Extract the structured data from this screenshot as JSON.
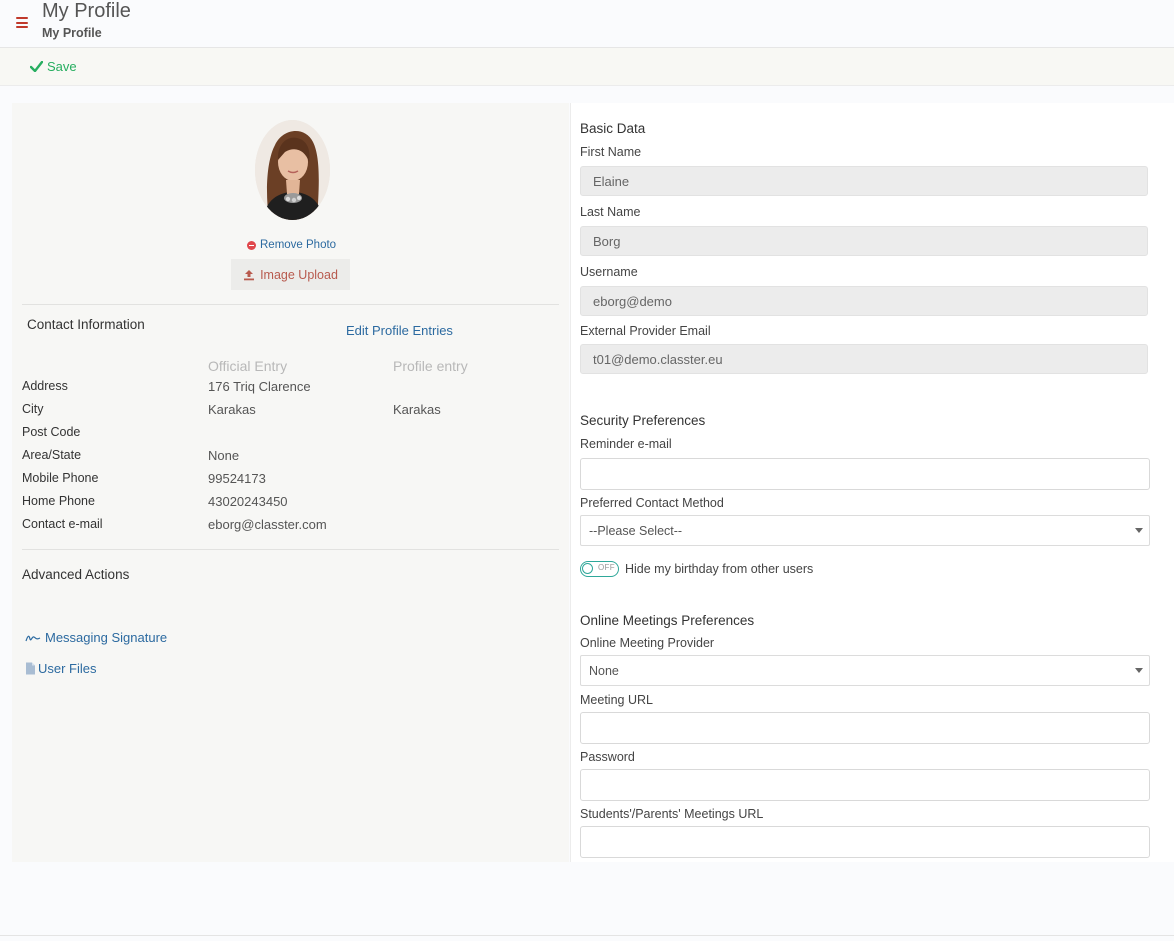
{
  "header": {
    "title": "My Profile",
    "subtitle": "My Profile",
    "menu_icon": "hamburger-icon",
    "accent_color": "#c0392b"
  },
  "toolbar": {
    "save_label": "Save",
    "save_color": "#27ae60"
  },
  "photo": {
    "remove_label": "Remove Photo",
    "upload_label": "Image Upload"
  },
  "contact": {
    "title": "Contact Information",
    "edit_label": "Edit Profile Entries",
    "col_official": "Official Entry",
    "col_profile": "Profile entry",
    "rows": [
      {
        "label": "Address",
        "official": "176 Triq Clarence",
        "profile": ""
      },
      {
        "label": "City",
        "official": "Karakas",
        "profile": "Karakas"
      },
      {
        "label": "Post Code",
        "official": "",
        "profile": ""
      },
      {
        "label": "Area/State",
        "official": "None",
        "profile": ""
      },
      {
        "label": "Mobile Phone",
        "official": "99524173",
        "profile": ""
      },
      {
        "label": "Home Phone",
        "official": "43020243450",
        "profile": ""
      },
      {
        "label": "Contact e-mail",
        "official": "eborg@classter.com",
        "profile": ""
      }
    ]
  },
  "advanced": {
    "title": "Advanced Actions",
    "messaging_signature": "Messaging Signature",
    "user_files": "User Files"
  },
  "basic": {
    "title": "Basic Data",
    "first_name_label": "First Name",
    "first_name": "Elaine",
    "last_name_label": "Last Name",
    "last_name": "Borg",
    "username_label": "Username",
    "username": "eborg@demo",
    "ext_email_label": "External Provider Email",
    "ext_email": "t01@demo.classter.eu"
  },
  "security": {
    "title": "Security Preferences",
    "reminder_label": "Reminder e-mail",
    "reminder_value": "",
    "contact_method_label": "Preferred Contact Method",
    "contact_method_value": "--Please Select--",
    "toggle_state": "OFF",
    "toggle_label": "Hide my birthday from other users"
  },
  "meetings": {
    "title": "Online Meetings Preferences",
    "provider_label": "Online Meeting Provider",
    "provider_value": "None",
    "url_label": "Meeting URL",
    "password_label": "Password",
    "students_url_label": "Students'/Parents' Meetings URL"
  }
}
